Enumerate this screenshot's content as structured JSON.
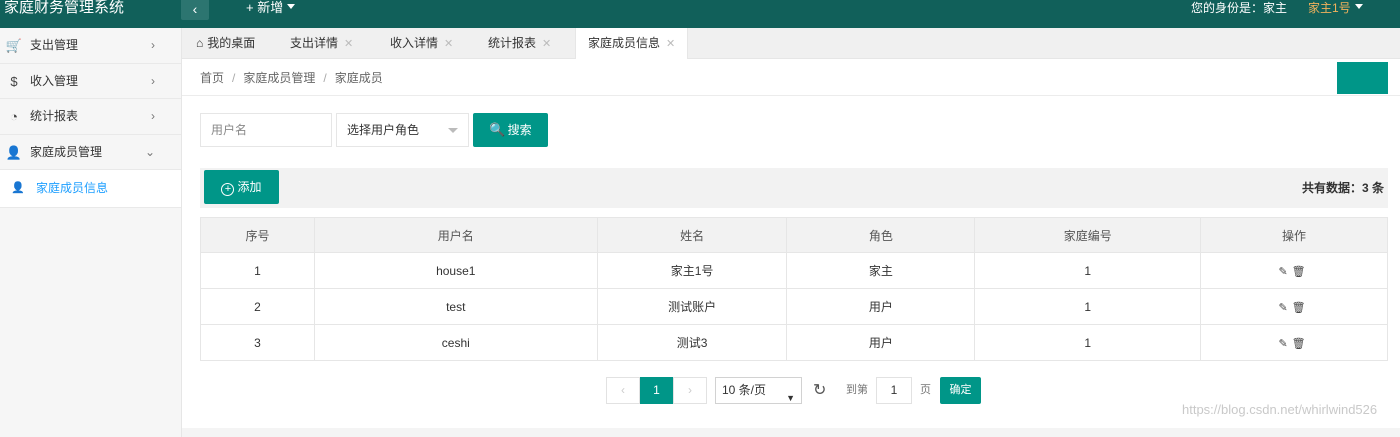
{
  "header": {
    "title": "家庭财务管理系统",
    "collapse_icon": "‹",
    "new_label": "+ 新增",
    "identity_label": "您的身份是：家主",
    "user_name": "家主1号"
  },
  "sidebar": {
    "items": [
      {
        "label": "支出管理",
        "icon": "cart-icon",
        "glyph": "🛒",
        "arrow": "›"
      },
      {
        "label": "收入管理",
        "icon": "dollar-icon",
        "glyph": "$",
        "arrow": "›"
      },
      {
        "label": "统计报表",
        "icon": "chart-icon",
        "glyph": "◔",
        "arrow": "›"
      },
      {
        "label": "家庭成员管理",
        "icon": "user-icon",
        "glyph": "👤",
        "arrow": "⌄"
      }
    ],
    "subitems": [
      {
        "label": "家庭成员信息",
        "icon": "user-icon",
        "glyph": "👤"
      }
    ]
  },
  "tabs": [
    {
      "label": "我的桌面",
      "closable": false
    },
    {
      "label": "支出详情",
      "closable": true
    },
    {
      "label": "收入详情",
      "closable": true
    },
    {
      "label": "统计报表",
      "closable": true
    },
    {
      "label": "家庭成员信息",
      "closable": true,
      "active": true
    }
  ],
  "tab_close_glyph": "✕",
  "breadcrumb": [
    "首页",
    "家庭成员管理",
    "家庭成员"
  ],
  "breadcrumb_sep": "/",
  "search": {
    "username_placeholder": "用户名",
    "username_value": "",
    "role_selected": "选择用户角色",
    "search_label": "搜索"
  },
  "toolbar": {
    "add_label": "添加",
    "total_text": "共有数据：3 条"
  },
  "table": {
    "columns": [
      "序号",
      "用户名",
      "姓名",
      "角色",
      "家庭编号",
      "操作"
    ],
    "rows": [
      [
        "1",
        "house1",
        "家主1号",
        "家主",
        "1"
      ],
      [
        "2",
        "test",
        "测试账户",
        "用户",
        "1"
      ],
      [
        "3",
        "ceshi",
        "测试3",
        "用户",
        "1"
      ]
    ],
    "edit_icon": "pencil-icon",
    "delete_icon": "trash-icon"
  },
  "pager": {
    "prev": "‹",
    "current": "1",
    "next": "›",
    "page_size": "10 条/页",
    "goto_label": "到第",
    "goto_value": "1",
    "page_label": "页",
    "confirm_label": "确定"
  },
  "watermark": "https://blog.csdn.net/whirlwind526"
}
